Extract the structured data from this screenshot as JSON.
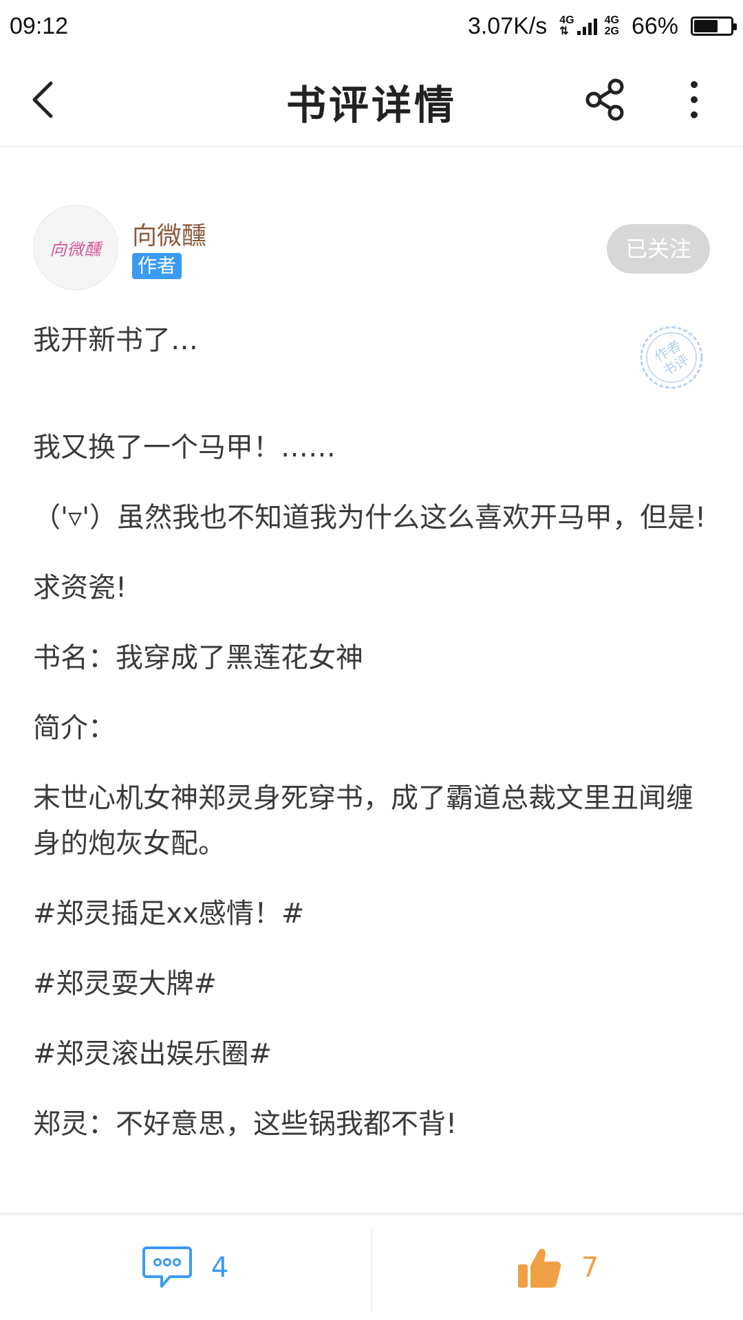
{
  "status_bar": {
    "time": "09:12",
    "speed": "3.07K/s",
    "net_top": "4G",
    "net_bottom": "2G",
    "battery_text": "66%",
    "battery_level": 0.66
  },
  "header": {
    "title": "书评详情",
    "back_icon": "chevron-left-icon",
    "share_icon": "share-icon",
    "more_icon": "more-vertical-icon"
  },
  "author": {
    "name": "向微醺",
    "avatar_text": "向微醺",
    "badge": "作者",
    "follow_label": "已关注"
  },
  "stamp": {
    "line1": "作者",
    "line2": "书评"
  },
  "post": {
    "paragraphs": [
      "我开新书了…",
      "我又换了一个马甲！……",
      "（'▿'）虽然我也不知道我为什么这么喜欢开马甲，但是!",
      "求资瓷!",
      "书名：我穿成了黑莲花女神",
      "简介：",
      "末世心机女神郑灵身死穿书，成了霸道总裁文里丑闻缠身的炮灰女配。",
      "#郑灵插足xx感情！#",
      "#郑灵耍大牌#",
      "#郑灵滚出娱乐圈#",
      "郑灵：不好意思，这些锅我都不背!"
    ]
  },
  "bottom_bar": {
    "comment_icon": "comment-icon",
    "comment_count": "4",
    "like_icon": "thumbs-up-icon",
    "like_count": "7"
  },
  "colors": {
    "accent_blue": "#3b9bf3",
    "like_orange": "#f0a044",
    "author_name": "#8b5a3c",
    "follow_bg": "#d7d7d7"
  }
}
